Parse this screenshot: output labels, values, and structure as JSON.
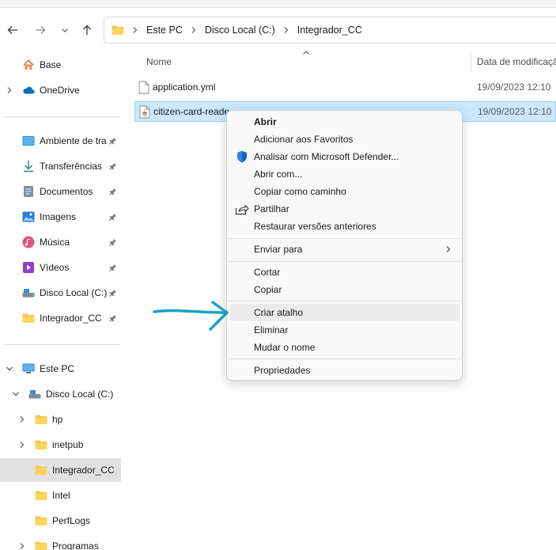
{
  "address": {
    "crumbs": [
      "Este PC",
      "Disco Local (C:)",
      "Integrador_CC"
    ]
  },
  "sidebar": {
    "top_items": [
      {
        "label": "Base",
        "icon": "home-icon"
      },
      {
        "label": "OneDrive",
        "icon": "cloud-icon"
      }
    ],
    "quick_access": [
      {
        "label": "Ambiente de tra",
        "icon": "desktop-icon"
      },
      {
        "label": "Transferências",
        "icon": "download-icon"
      },
      {
        "label": "Documentos",
        "icon": "document-icon"
      },
      {
        "label": "Imagens",
        "icon": "image-icon"
      },
      {
        "label": "Música",
        "icon": "music-icon"
      },
      {
        "label": "Vídeos",
        "icon": "video-icon"
      },
      {
        "label": "Disco Local (C:)",
        "icon": "drive-icon"
      },
      {
        "label": "Integrador_CC",
        "icon": "folder-icon"
      }
    ],
    "tree": [
      {
        "label": "Este PC",
        "icon": "monitor-icon"
      },
      {
        "label": "Disco Local (C:)",
        "icon": "drive-icon"
      },
      {
        "label": "hp",
        "icon": "folder-icon"
      },
      {
        "label": "inetpub",
        "icon": "folder-icon"
      },
      {
        "label": "Integrador_CC",
        "icon": "folder-icon"
      },
      {
        "label": "Intel",
        "icon": "folder-icon"
      },
      {
        "label": "PerfLogs",
        "icon": "folder-icon"
      },
      {
        "label": "Programas",
        "icon": "folder-icon"
      }
    ]
  },
  "columns": {
    "name": "Nome",
    "date": "Data de modificaçã"
  },
  "files": [
    {
      "name": "application.yml",
      "date": "19/09/2023 12:10"
    },
    {
      "name": "citizen-card-reade",
      "date": "19/09/2023 12:10"
    }
  ],
  "context_menu": {
    "items": [
      {
        "label": "Abrir"
      },
      {
        "label": "Adicionar aos Favoritos"
      },
      {
        "label": "Analisar com Microsoft Defender..."
      },
      {
        "label": "Abrir com..."
      },
      {
        "label": "Copiar como caminho"
      },
      {
        "label": "Partilhar"
      },
      {
        "label": "Restaurar versões anteriores"
      },
      {
        "label": "Enviar para"
      },
      {
        "label": "Cortar"
      },
      {
        "label": "Copiar"
      },
      {
        "label": "Criar atalho"
      },
      {
        "label": "Eliminar"
      },
      {
        "label": "Mudar o nome"
      },
      {
        "label": "Propriedades"
      }
    ]
  },
  "colors": {
    "selection": "#cce8ff",
    "annotation_arrow": "#1aa3c4",
    "folder": "#f4c542",
    "defender": "#1565c0"
  }
}
